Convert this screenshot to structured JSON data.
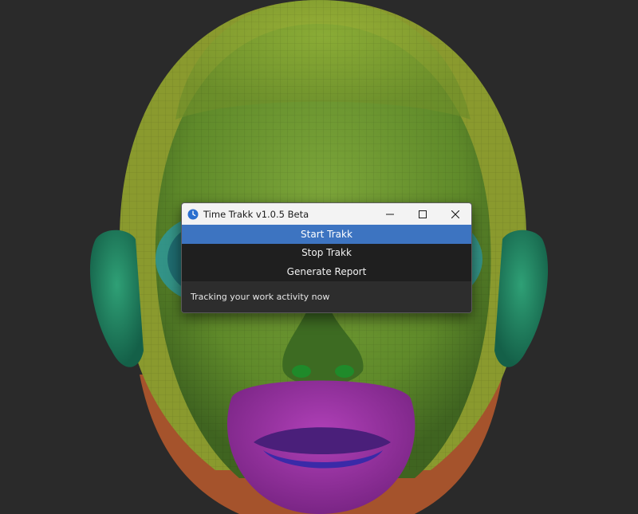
{
  "window": {
    "title": "Time Trakk v1.0.5 Beta",
    "app_icon": "clock-icon",
    "caption_icons": [
      "minimize-icon",
      "maximize-icon",
      "close-icon"
    ]
  },
  "menu": {
    "items": [
      {
        "label": "Start Trakk",
        "selected": true
      },
      {
        "label": "Stop Trakk",
        "selected": false
      },
      {
        "label": "Generate Report",
        "selected": false
      }
    ]
  },
  "status": {
    "text": "Tracking your work activity now"
  },
  "colors": {
    "selection": "#3d74c1",
    "menu_bg": "#1f1f1f",
    "titlebar_bg": "#f3f3f3",
    "status_bg": "#2d2d2d"
  }
}
